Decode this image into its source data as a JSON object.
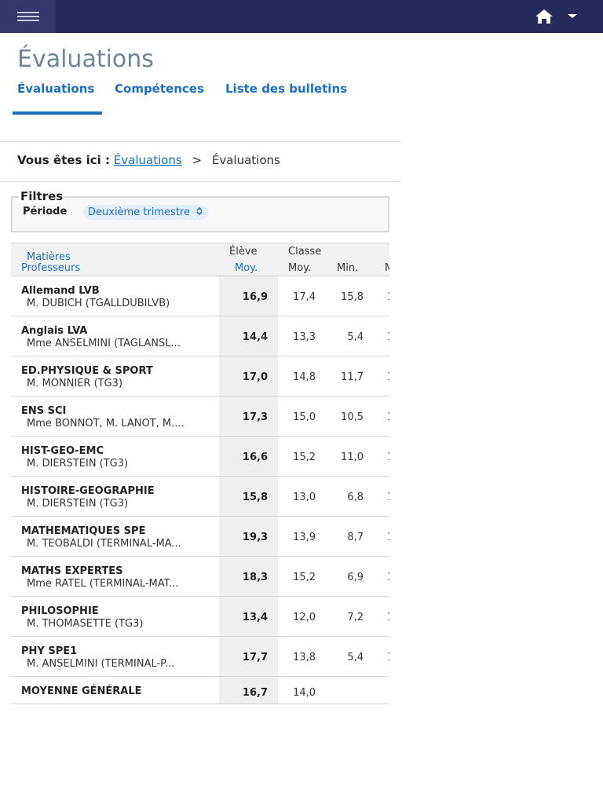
{
  "header": {
    "menu_icon": "hamburger-icon",
    "home_icon": "home-icon",
    "dropdown_icon": "caret-down-icon"
  },
  "page": {
    "title": "Évaluations"
  },
  "tabs": [
    {
      "label": "Évaluations",
      "active": true
    },
    {
      "label": "Compétences",
      "active": false
    },
    {
      "label": "Liste des bulletins",
      "active": false
    }
  ],
  "breadcrumb": {
    "prefix": "Vous êtes ici :",
    "link": "Évaluations",
    "separator": ">",
    "current": "Évaluations"
  },
  "filters": {
    "legend": "Filtres",
    "period_label": "Période",
    "period_value": "Deuxième trimestre"
  },
  "table": {
    "head": {
      "subjects": "Matières",
      "teachers": "Professeurs",
      "eleve": "Élève",
      "eleve_moy": "Moy.",
      "classe": "Classe",
      "classe_moy": "Moy.",
      "classe_min": "Min.",
      "classe_max_partial": "M"
    },
    "rows": [
      {
        "subject": "Allemand LVB",
        "teacher": "M. DUBICH (TGALLDUBILVB)",
        "eleve": "16,9",
        "moy": "17,4",
        "min": "15,8",
        "max": "1"
      },
      {
        "subject": "Anglais LVA",
        "teacher": "Mme ANSELMINI (TAGLANSL...",
        "eleve": "14,4",
        "moy": "13,3",
        "min": "5,4",
        "max": "1"
      },
      {
        "subject": "ED.PHYSIQUE & SPORT",
        "teacher": "M. MONNIER (TG3)",
        "eleve": "17,0",
        "moy": "14,8",
        "min": "11,7",
        "max": "1"
      },
      {
        "subject": "ENS SCI",
        "teacher": "Mme BONNOT, M. LANOT, M....",
        "eleve": "17,3",
        "moy": "15,0",
        "min": "10,5",
        "max": "1"
      },
      {
        "subject": "HIST-GEO-EMC",
        "teacher": "M. DIERSTEIN (TG3)",
        "eleve": "16,6",
        "moy": "15,2",
        "min": "11,0",
        "max": "1"
      },
      {
        "subject": "HISTOIRE-GEOGRAPHIE",
        "teacher": "M. DIERSTEIN (TG3)",
        "eleve": "15,8",
        "moy": "13,0",
        "min": "6,8",
        "max": "1"
      },
      {
        "subject": "MATHEMATIQUES SPE",
        "teacher": "M. TEOBALDI (TERMINAL-MA...",
        "eleve": "19,3",
        "moy": "13,9",
        "min": "8,7",
        "max": "1"
      },
      {
        "subject": "MATHS EXPERTES",
        "teacher": "Mme RATEL (TERMINAL-MAT...",
        "eleve": "18,3",
        "moy": "15,2",
        "min": "6,9",
        "max": "1"
      },
      {
        "subject": "PHILOSOPHIE",
        "teacher": "M. THOMASETTE (TG3)",
        "eleve": "13,4",
        "moy": "12,0",
        "min": "7,2",
        "max": "1"
      },
      {
        "subject": "PHY SPE1",
        "teacher": "M. ANSELMINI (TERMINAL-P...",
        "eleve": "17,7",
        "moy": "13,8",
        "min": "5,4",
        "max": "1"
      }
    ],
    "total": {
      "label": "MOYENNE GÉNÉRALE",
      "eleve": "16,7",
      "moy": "14,0"
    }
  }
}
